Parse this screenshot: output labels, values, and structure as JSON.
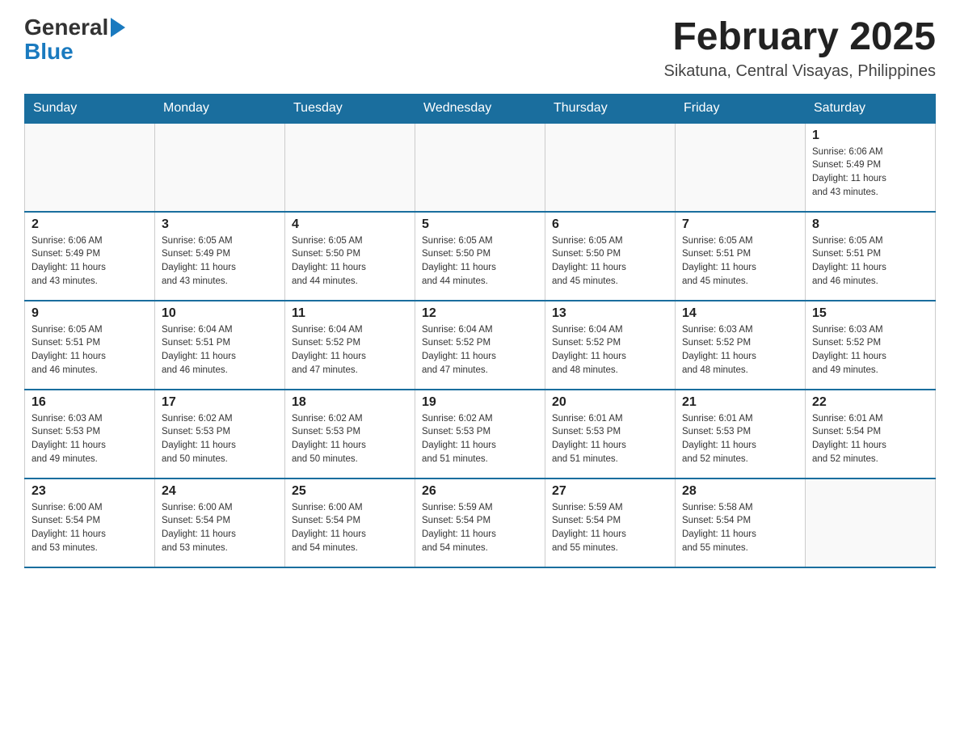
{
  "header": {
    "logo_general": "General",
    "logo_blue": "Blue",
    "month_title": "February 2025",
    "location": "Sikatuna, Central Visayas, Philippines"
  },
  "weekdays": [
    "Sunday",
    "Monday",
    "Tuesday",
    "Wednesday",
    "Thursday",
    "Friday",
    "Saturday"
  ],
  "weeks": [
    [
      {
        "day": "",
        "info": ""
      },
      {
        "day": "",
        "info": ""
      },
      {
        "day": "",
        "info": ""
      },
      {
        "day": "",
        "info": ""
      },
      {
        "day": "",
        "info": ""
      },
      {
        "day": "",
        "info": ""
      },
      {
        "day": "1",
        "info": "Sunrise: 6:06 AM\nSunset: 5:49 PM\nDaylight: 11 hours\nand 43 minutes."
      }
    ],
    [
      {
        "day": "2",
        "info": "Sunrise: 6:06 AM\nSunset: 5:49 PM\nDaylight: 11 hours\nand 43 minutes."
      },
      {
        "day": "3",
        "info": "Sunrise: 6:05 AM\nSunset: 5:49 PM\nDaylight: 11 hours\nand 43 minutes."
      },
      {
        "day": "4",
        "info": "Sunrise: 6:05 AM\nSunset: 5:50 PM\nDaylight: 11 hours\nand 44 minutes."
      },
      {
        "day": "5",
        "info": "Sunrise: 6:05 AM\nSunset: 5:50 PM\nDaylight: 11 hours\nand 44 minutes."
      },
      {
        "day": "6",
        "info": "Sunrise: 6:05 AM\nSunset: 5:50 PM\nDaylight: 11 hours\nand 45 minutes."
      },
      {
        "day": "7",
        "info": "Sunrise: 6:05 AM\nSunset: 5:51 PM\nDaylight: 11 hours\nand 45 minutes."
      },
      {
        "day": "8",
        "info": "Sunrise: 6:05 AM\nSunset: 5:51 PM\nDaylight: 11 hours\nand 46 minutes."
      }
    ],
    [
      {
        "day": "9",
        "info": "Sunrise: 6:05 AM\nSunset: 5:51 PM\nDaylight: 11 hours\nand 46 minutes."
      },
      {
        "day": "10",
        "info": "Sunrise: 6:04 AM\nSunset: 5:51 PM\nDaylight: 11 hours\nand 46 minutes."
      },
      {
        "day": "11",
        "info": "Sunrise: 6:04 AM\nSunset: 5:52 PM\nDaylight: 11 hours\nand 47 minutes."
      },
      {
        "day": "12",
        "info": "Sunrise: 6:04 AM\nSunset: 5:52 PM\nDaylight: 11 hours\nand 47 minutes."
      },
      {
        "day": "13",
        "info": "Sunrise: 6:04 AM\nSunset: 5:52 PM\nDaylight: 11 hours\nand 48 minutes."
      },
      {
        "day": "14",
        "info": "Sunrise: 6:03 AM\nSunset: 5:52 PM\nDaylight: 11 hours\nand 48 minutes."
      },
      {
        "day": "15",
        "info": "Sunrise: 6:03 AM\nSunset: 5:52 PM\nDaylight: 11 hours\nand 49 minutes."
      }
    ],
    [
      {
        "day": "16",
        "info": "Sunrise: 6:03 AM\nSunset: 5:53 PM\nDaylight: 11 hours\nand 49 minutes."
      },
      {
        "day": "17",
        "info": "Sunrise: 6:02 AM\nSunset: 5:53 PM\nDaylight: 11 hours\nand 50 minutes."
      },
      {
        "day": "18",
        "info": "Sunrise: 6:02 AM\nSunset: 5:53 PM\nDaylight: 11 hours\nand 50 minutes."
      },
      {
        "day": "19",
        "info": "Sunrise: 6:02 AM\nSunset: 5:53 PM\nDaylight: 11 hours\nand 51 minutes."
      },
      {
        "day": "20",
        "info": "Sunrise: 6:01 AM\nSunset: 5:53 PM\nDaylight: 11 hours\nand 51 minutes."
      },
      {
        "day": "21",
        "info": "Sunrise: 6:01 AM\nSunset: 5:53 PM\nDaylight: 11 hours\nand 52 minutes."
      },
      {
        "day": "22",
        "info": "Sunrise: 6:01 AM\nSunset: 5:54 PM\nDaylight: 11 hours\nand 52 minutes."
      }
    ],
    [
      {
        "day": "23",
        "info": "Sunrise: 6:00 AM\nSunset: 5:54 PM\nDaylight: 11 hours\nand 53 minutes."
      },
      {
        "day": "24",
        "info": "Sunrise: 6:00 AM\nSunset: 5:54 PM\nDaylight: 11 hours\nand 53 minutes."
      },
      {
        "day": "25",
        "info": "Sunrise: 6:00 AM\nSunset: 5:54 PM\nDaylight: 11 hours\nand 54 minutes."
      },
      {
        "day": "26",
        "info": "Sunrise: 5:59 AM\nSunset: 5:54 PM\nDaylight: 11 hours\nand 54 minutes."
      },
      {
        "day": "27",
        "info": "Sunrise: 5:59 AM\nSunset: 5:54 PM\nDaylight: 11 hours\nand 55 minutes."
      },
      {
        "day": "28",
        "info": "Sunrise: 5:58 AM\nSunset: 5:54 PM\nDaylight: 11 hours\nand 55 minutes."
      },
      {
        "day": "",
        "info": ""
      }
    ]
  ]
}
